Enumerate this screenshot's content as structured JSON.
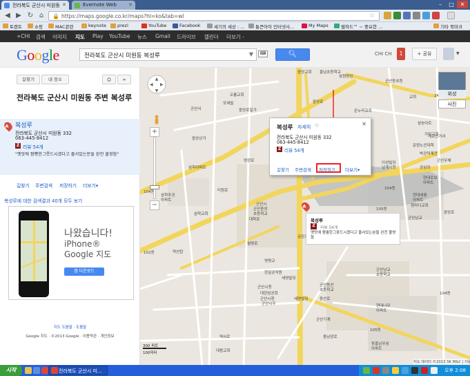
{
  "browser": {
    "tabs": [
      {
        "title": "전라북도 군산시 미원동",
        "favicon_color": "#4a8af4"
      },
      {
        "title": "Evernote Web",
        "favicon_color": "#6ab648"
      }
    ],
    "url": "https://maps.google.co.kr/maps?hl=ko&tab=wl",
    "window_controls": [
      "–",
      "□",
      "✕"
    ],
    "bookmarks": [
      {
        "label": "토렌트",
        "color": "#e0a040"
      },
      {
        "label": "쇼핑",
        "color": "#e0a040"
      },
      {
        "label": "MAC관련",
        "color": "#e0a040"
      },
      {
        "label": "keynote",
        "color": "#e0a040"
      },
      {
        "label": "prezi",
        "color": "#e0a040"
      },
      {
        "label": "YouTube",
        "color": "#d32"
      },
      {
        "label": "Facebook",
        "color": "#3b5998"
      },
      {
        "label": "세기의 세상 : ...",
        "color": "#999"
      },
      {
        "label": "통큰아이 인터넷사...",
        "color": "#999"
      },
      {
        "label": "My Maps",
        "color": "#d14"
      },
      {
        "label": "웹하드™ ~ 중요한 ...",
        "color": "#3a7"
      },
      {
        "label": "기타 북마크",
        "color": "#e0a040"
      }
    ]
  },
  "gbar": {
    "items": [
      "+CHI",
      "검색",
      "이미지",
      "지도",
      "Play",
      "YouTube",
      "뉴스",
      "Gmail",
      "드라이브",
      "캘린더",
      "더보기 -"
    ],
    "active": "지도"
  },
  "header": {
    "logo_letters": [
      {
        "ch": "G",
        "color": "#3369e8"
      },
      {
        "ch": "o",
        "color": "#d50f25"
      },
      {
        "ch": "o",
        "color": "#eeb211"
      },
      {
        "ch": "g",
        "color": "#3369e8"
      },
      {
        "ch": "l",
        "color": "#009925"
      },
      {
        "ch": "e",
        "color": "#d50f25"
      }
    ],
    "search_value": "전라북도 군산시 미원동 복성루",
    "account": "CHI CH",
    "notifications": "1",
    "share": "+ 공유"
  },
  "sidebar": {
    "directions_btn": "길찾기",
    "myplaces_btn": "내 장소",
    "title": "전라북도 군산시 미원동 주변 복성루",
    "result": {
      "marker": "A",
      "name": "복성루",
      "address": "전라북도 군산시 미원동 332",
      "phone": "063-445-8412",
      "zagat": "Z",
      "reviews": "리뷰 54개",
      "quote": "\"옛맛에 짬뽕한그릇드시겠다고 줄서있는분들 완전 불쌍함\""
    },
    "actions": [
      "길찾기",
      "주변검색",
      "저장하기",
      "더보기▾"
    ],
    "more_results": "복성루에 대한 검색결과 40개 모두 보기",
    "ad": {
      "headline": "나왔습니다!",
      "line1": "iPhone®",
      "line2": "Google 지도",
      "button": "앱 다운로드"
    },
    "footer_links": "지도 도움말 · 도움말",
    "footer_copy": "Google 지도 · ©2013 Google · 이용약관 · 개인정보"
  },
  "map": {
    "popup": {
      "name": "복성루",
      "detail": "자세히",
      "address": "전라북도 군산시 미원동 332",
      "phone": "063-445-8412",
      "zagat": "Z",
      "reviews": "리뷰 54개",
      "actions": [
        "길찾기",
        "주변검색",
        "저장하기",
        "더보기▾"
      ],
      "close": "✕"
    },
    "marker_bubble": {
      "name": "복성루",
      "reviews": "리뷰 54개",
      "quote": "옛맛에 짬뽕한그릇드시겠다고 줄서있는분들 완전 불쌍함"
    },
    "satellite_label": "위성",
    "photos_label": "사진",
    "scale_top": "300 피트",
    "scale_bottom": "100미터",
    "copyright": "지도 데이터 ©2013 SK M&C | 이용약관",
    "labels": [
      {
        "text": "중앙교회",
        "l": 228,
        "t": 2
      },
      {
        "text": "흥남초등학교",
        "l": 260,
        "t": 2
      },
      {
        "text": "군산동초등",
        "l": 355,
        "t": 15
      },
      {
        "text": "온누리교회",
        "l": 310,
        "t": 58
      },
      {
        "text": "삼원장신",
        "l": 288,
        "t": 8
      },
      {
        "text": "중앙로",
        "l": 250,
        "t": 45
      },
      {
        "text": "오룡교회",
        "l": 130,
        "t": 35
      },
      {
        "text": "모세빌",
        "l": 120,
        "t": 47
      },
      {
        "text": "중앙로일가",
        "l": 143,
        "t": 57
      },
      {
        "text": "군산서",
        "l": 73,
        "t": 55
      },
      {
        "text": "중앙상가",
        "l": 75,
        "t": 98
      },
      {
        "text": "영광로",
        "l": 150,
        "t": 130
      },
      {
        "text": "삼학아파트",
        "l": 70,
        "t": 140
      },
      {
        "text": "미원로",
        "l": 112,
        "t": 173
      },
      {
        "text": "삼학주공",
        "l": 30,
        "t": 180
      },
      {
        "text": "아파트",
        "l": 30,
        "t": 187
      },
      {
        "text": "104동",
        "l": 5,
        "t": 175
      },
      {
        "text": "삼학교회",
        "l": 78,
        "t": 207
      },
      {
        "text": "약산탑",
        "l": 47,
        "t": 262
      },
      {
        "text": "102동",
        "l": 5,
        "t": 263
      },
      {
        "text": "군산시",
        "l": 168,
        "t": 193
      },
      {
        "text": "군산중앙",
        "l": 164,
        "t": 200
      },
      {
        "text": "초등학교",
        "l": 164,
        "t": 207
      },
      {
        "text": "월명로",
        "l": 155,
        "t": 250
      },
      {
        "text": "대학로",
        "l": 158,
        "t": 215
      },
      {
        "text": "금강로",
        "l": 228,
        "t": 240
      },
      {
        "text": "영명교",
        "l": 180,
        "t": 275
      },
      {
        "text": "한일공작원",
        "l": 180,
        "t": 292
      },
      {
        "text": "군산시청",
        "l": 170,
        "t": 313
      },
      {
        "text": "세영빌딩",
        "l": 205,
        "t": 300
      },
      {
        "text": "대한엄공회",
        "l": 174,
        "t": 322
      },
      {
        "text": "군산시청",
        "l": 174,
        "t": 330
      },
      {
        "text": "군산시우",
        "l": 176,
        "t": 337
      },
      {
        "text": "세명빌딩",
        "l": 223,
        "t": 330
      },
      {
        "text": "군산동산",
        "l": 260,
        "t": 310
      },
      {
        "text": "초등학교",
        "l": 260,
        "t": 317
      },
      {
        "text": "동산로",
        "l": 260,
        "t": 330
      },
      {
        "text": "군산기계",
        "l": 255,
        "t": 360
      },
      {
        "text": "충남광로",
        "l": 265,
        "t": 385
      },
      {
        "text": "대용교회",
        "l": 110,
        "t": 405
      },
      {
        "text": "역사로",
        "l": 115,
        "t": 385
      },
      {
        "text": "교회",
        "l": 390,
        "t": 38
      },
      {
        "text": "24",
        "l": 426,
        "t": 38
      },
      {
        "text": "개교신거리",
        "l": 417,
        "t": 95
      },
      {
        "text": "문원노인대학",
        "l": 395,
        "t": 108
      },
      {
        "text": "박강약계건",
        "l": 405,
        "t": 120
      },
      {
        "text": "군산우체",
        "l": 430,
        "t": 130
      },
      {
        "text": "이성빌딩",
        "l": 350,
        "t": 133
      },
      {
        "text": "남계시장",
        "l": 350,
        "t": 140
      },
      {
        "text": "공심의",
        "l": 405,
        "t": 140
      },
      {
        "text": "현대로보",
        "l": 410,
        "t": 155
      },
      {
        "text": "아파트",
        "l": 410,
        "t": 162
      },
      {
        "text": "현대세움",
        "l": 395,
        "t": 180
      },
      {
        "text": "아파트",
        "l": 395,
        "t": 187
      },
      {
        "text": "청마디교회",
        "l": 392,
        "t": 195
      },
      {
        "text": "중앙로",
        "l": 440,
        "t": 205
      },
      {
        "text": "104동",
        "l": 354,
        "t": 170
      },
      {
        "text": "105동",
        "l": 342,
        "t": 200
      },
      {
        "text": "군산남교",
        "l": 388,
        "t": 213
      },
      {
        "text": "군산남교",
        "l": 342,
        "t": 288
      },
      {
        "text": "초등학교",
        "l": 342,
        "t": 295
      },
      {
        "text": "현대나무",
        "l": 342,
        "t": 340
      },
      {
        "text": "아파트",
        "l": 342,
        "t": 347
      },
      {
        "text": "104동",
        "l": 434,
        "t": 322
      },
      {
        "text": "동흥남우성",
        "l": 335,
        "t": 395
      },
      {
        "text": "아파트",
        "l": 335,
        "t": 402
      },
      {
        "text": "105동",
        "l": 333,
        "t": 375
      },
      {
        "text": "가린교회",
        "l": 412,
        "t": 92
      },
      {
        "text": "삼농아트",
        "l": 402,
        "t": 76
      }
    ]
  },
  "taskbar": {
    "start": "시작",
    "active_window": "전라북도 군산시 미...",
    "clock": "오후 2:08"
  }
}
